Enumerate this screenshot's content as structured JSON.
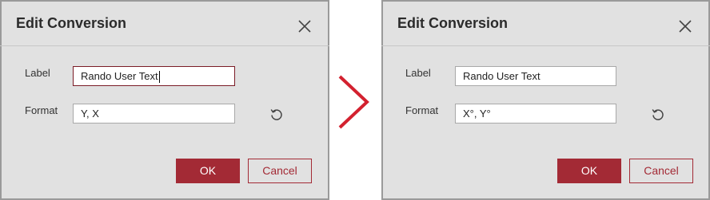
{
  "left_dialog": {
    "title": "Edit Conversion",
    "label_caption": "Label",
    "label_value": "Rando User Text",
    "format_caption": "Format",
    "format_value": "Y, X",
    "ok_label": "OK",
    "cancel_label": "Cancel"
  },
  "right_dialog": {
    "title": "Edit Conversion",
    "label_caption": "Label",
    "label_value": "Rando User Text",
    "format_caption": "Format",
    "format_value": "X°, Y°",
    "ok_label": "OK",
    "cancel_label": "Cancel"
  },
  "icons": {
    "close": "close-icon",
    "reset": "reset-icon",
    "arrow": "chevron-right-icon"
  },
  "colors": {
    "accent": "#a32a35",
    "dialog_bg": "#e1e1e1",
    "arrow": "#d3212f"
  }
}
